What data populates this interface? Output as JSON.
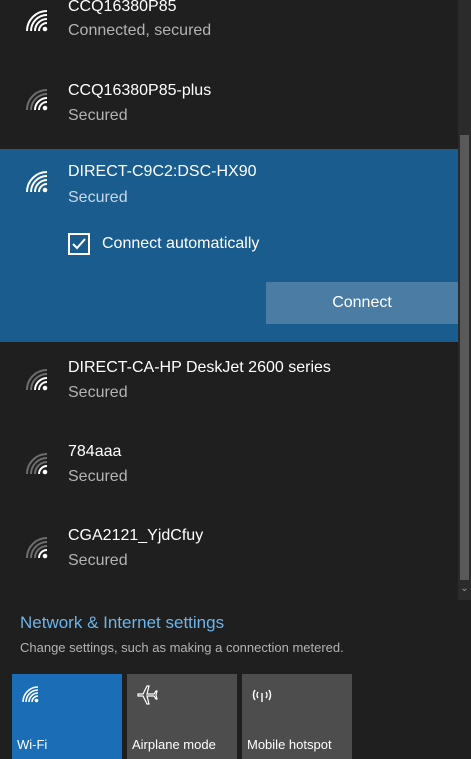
{
  "networks": [
    {
      "name": "CCQ16380P85",
      "status": "Connected, secured"
    },
    {
      "name": "CCQ16380P85-plus",
      "status": "Secured"
    },
    {
      "name": "DIRECT-C9C2:DSC-HX90",
      "status": "Secured",
      "auto_connect_label": "Connect automatically",
      "auto_connect_checked": true,
      "connect_label": "Connect"
    },
    {
      "name": "DIRECT-CA-HP DeskJet 2600 series",
      "status": "Secured"
    },
    {
      "name": "784aaa",
      "status": "Secured"
    },
    {
      "name": "CGA2121_YjdCfuy",
      "status": "Secured"
    }
  ],
  "settings": {
    "link_label": "Network & Internet settings",
    "description": "Change settings, such as making a connection metered."
  },
  "quick_actions": [
    {
      "label": "Wi-Fi",
      "icon": "wifi-icon",
      "active": true
    },
    {
      "label": "Airplane mode",
      "icon": "airplane-icon",
      "active": false
    },
    {
      "label": "Mobile hotspot",
      "icon": "hotspot-icon",
      "active": false
    }
  ],
  "colors": {
    "background": "#1f1f1f",
    "selected_item": "#1a5c8e",
    "connect_button": "#4a7ca4",
    "link": "#6cb4ea",
    "tile_active": "#1b6db5",
    "tile_inactive": "#4d4d4d"
  }
}
